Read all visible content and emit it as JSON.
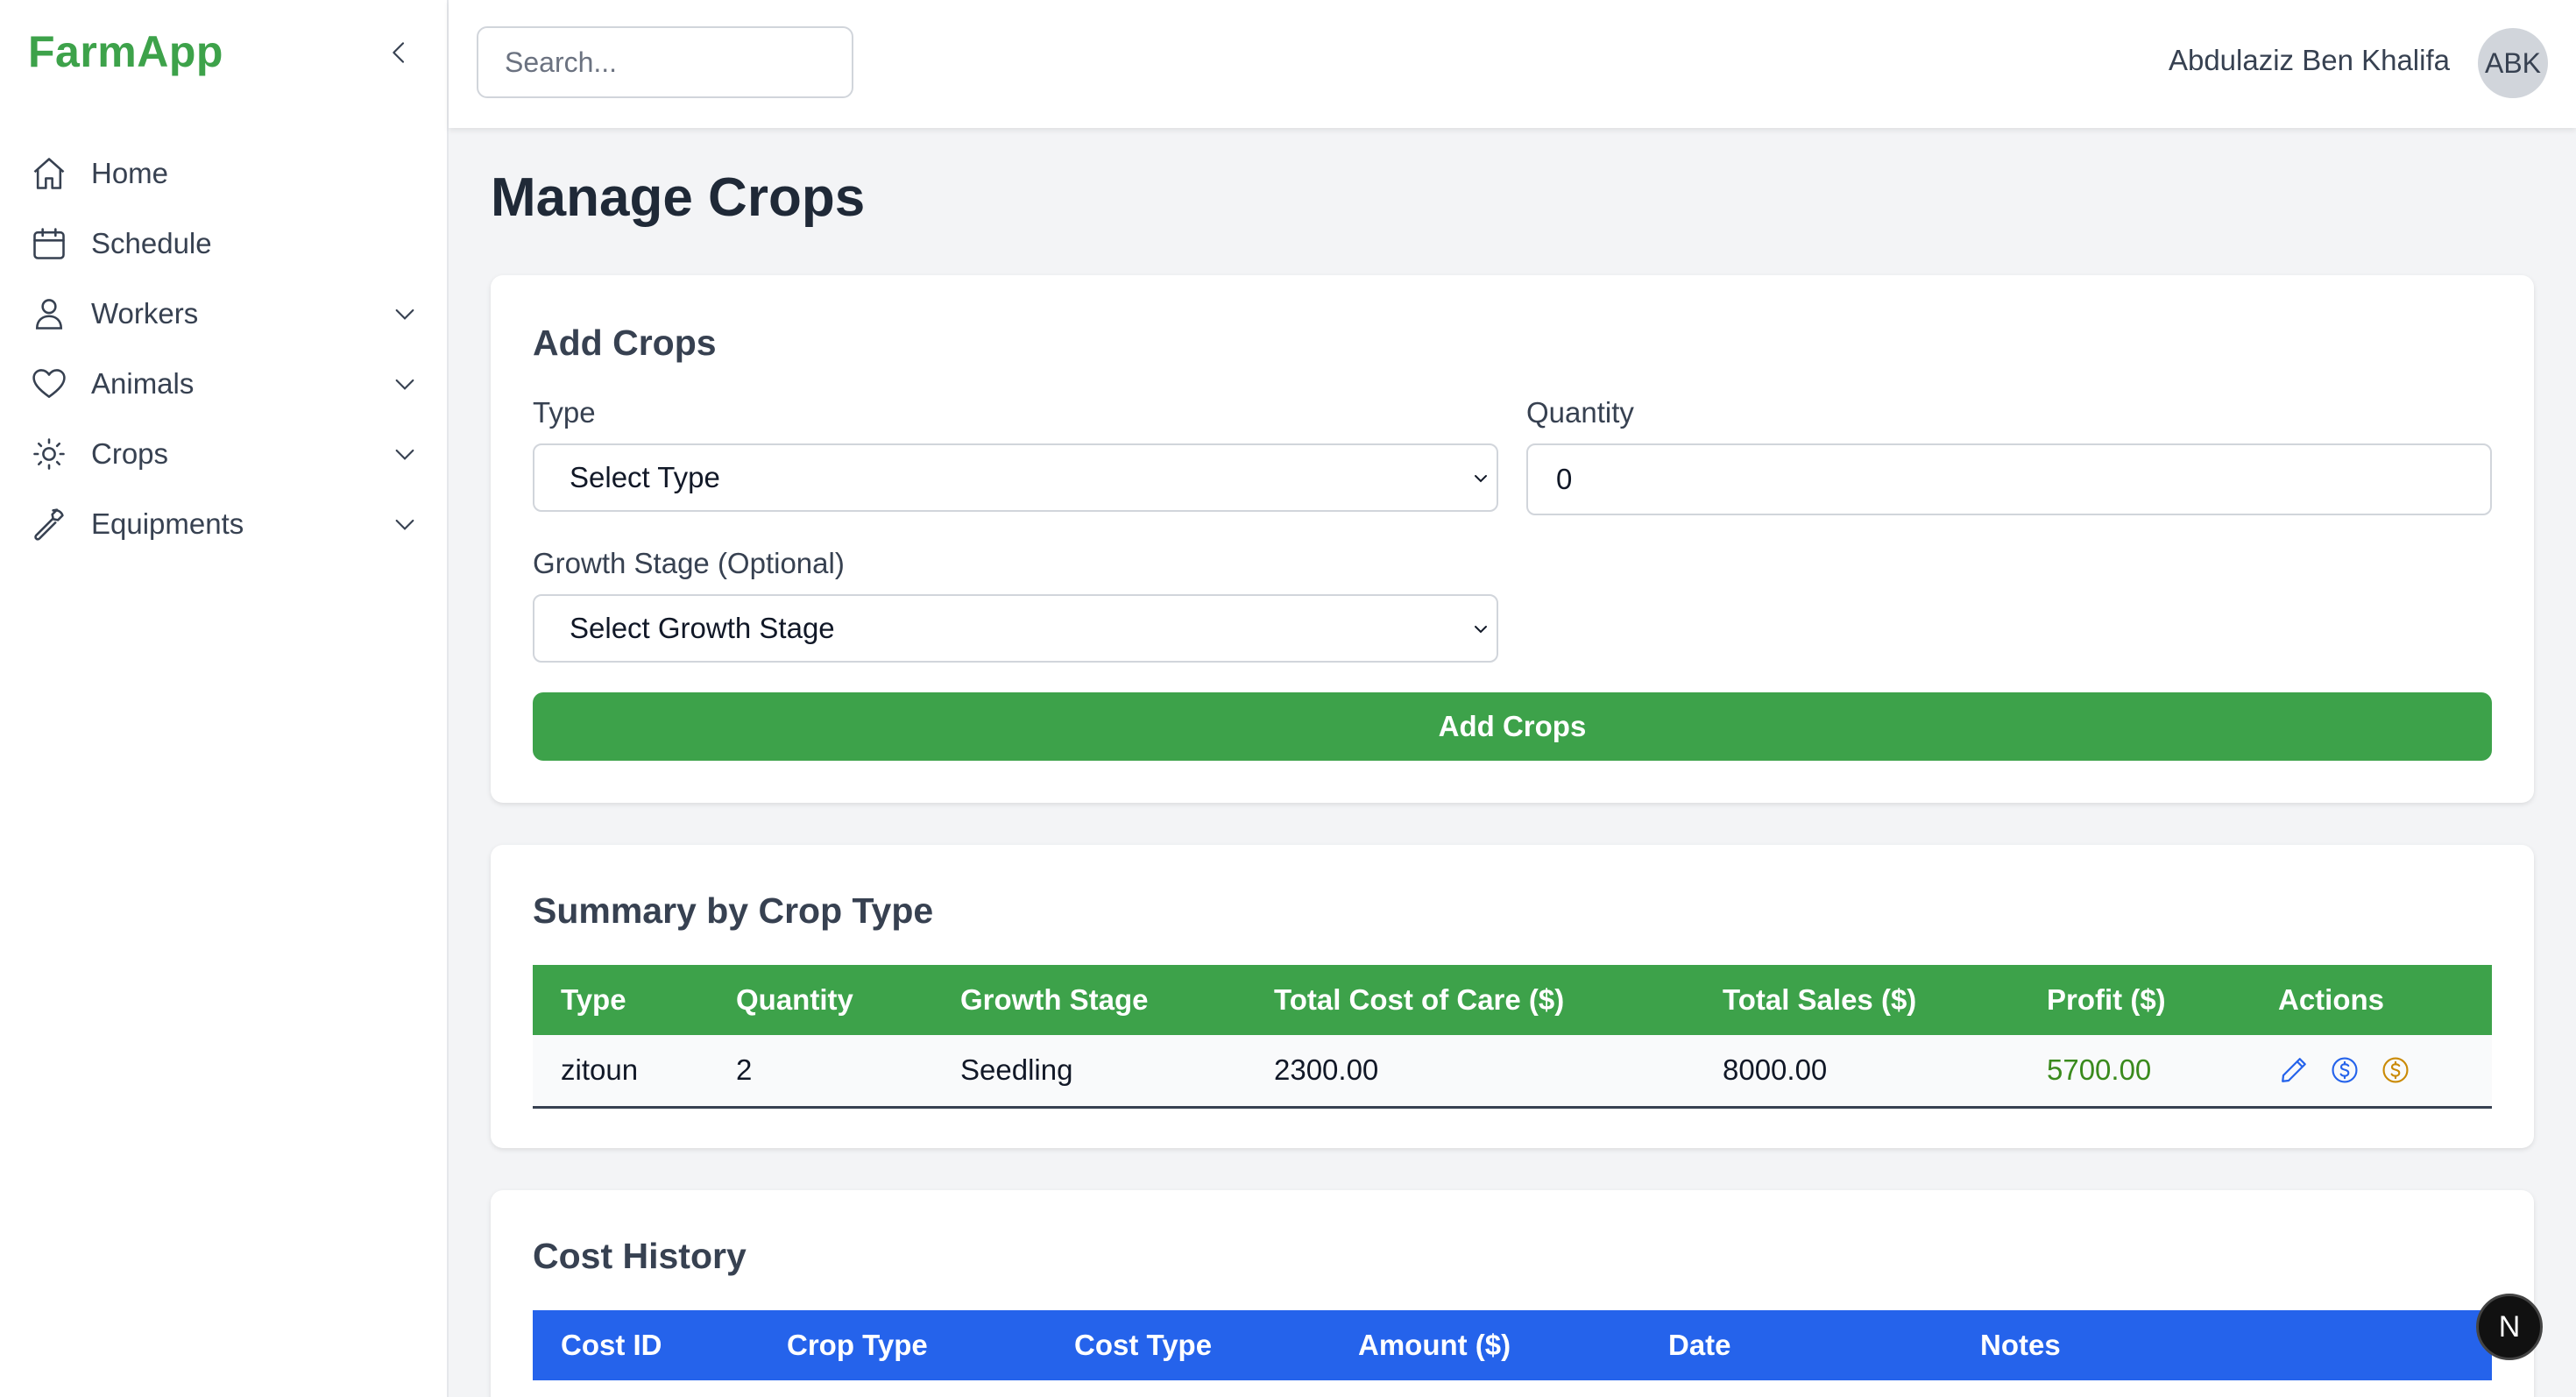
{
  "app": {
    "brand": "FarmApp"
  },
  "sidebar": {
    "items": [
      {
        "label": "Home",
        "icon": "home-icon",
        "has_submenu": false
      },
      {
        "label": "Schedule",
        "icon": "calendar-icon",
        "has_submenu": false
      },
      {
        "label": "Workers",
        "icon": "user-icon",
        "has_submenu": true
      },
      {
        "label": "Animals",
        "icon": "heart-icon",
        "has_submenu": true
      },
      {
        "label": "Crops",
        "icon": "sun-icon",
        "has_submenu": true
      },
      {
        "label": "Equipments",
        "icon": "wrench-icon",
        "has_submenu": true
      }
    ]
  },
  "header": {
    "search_placeholder": "Search...",
    "user_name": "Abdulaziz Ben Khalifa",
    "avatar_initials": "ABK"
  },
  "page": {
    "title": "Manage Crops"
  },
  "add_form": {
    "title": "Add Crops",
    "type_label": "Type",
    "type_value": "Select Type",
    "quantity_label": "Quantity",
    "quantity_value": "0",
    "growth_label": "Growth Stage (Optional)",
    "growth_value": "Select Growth Stage",
    "submit_label": "Add Crops"
  },
  "summary": {
    "title": "Summary by Crop Type",
    "columns": [
      "Type",
      "Quantity",
      "Growth Stage",
      "Total Cost of Care ($)",
      "Total Sales ($)",
      "Profit ($)",
      "Actions"
    ],
    "rows": [
      {
        "type": "zitoun",
        "quantity": "2",
        "growth_stage": "Seedling",
        "total_cost": "2300.00",
        "total_sales": "8000.00",
        "profit": "5700.00"
      }
    ]
  },
  "cost_history": {
    "title": "Cost History",
    "columns": [
      "Cost ID",
      "Crop Type",
      "Cost Type",
      "Amount ($)",
      "Date",
      "Notes"
    ]
  },
  "colors": {
    "brand_green": "#3da24a",
    "table_blue": "#2563eb",
    "profit_green": "#3a8a1d",
    "action_blue": "#2563eb",
    "action_gold": "#ca8a04"
  },
  "dev_badge": "N"
}
